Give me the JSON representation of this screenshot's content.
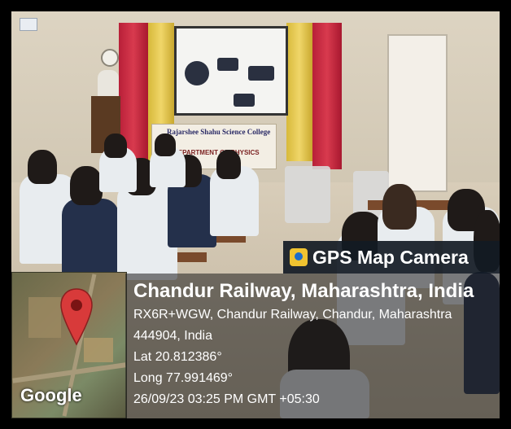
{
  "overlay": {
    "title": "GPS Map Camera",
    "location": "Chandur Railway, Maharashtra, India",
    "address_line1": "RX6R+WGW, Chandur Railway, Chandur, Maharashtra",
    "address_line2": "444904, India",
    "latitude": "Lat 20.812386°",
    "longitude": "Long 77.991469°",
    "timestamp": "26/09/23 03:25 PM GMT +05:30"
  },
  "map": {
    "logo": "Google",
    "pin_color": "#d83a3a"
  },
  "scene": {
    "banner_title": "Rajarshee Shahu Science College",
    "banner_sub": "DEPARTMENT OF PHYSICS"
  }
}
